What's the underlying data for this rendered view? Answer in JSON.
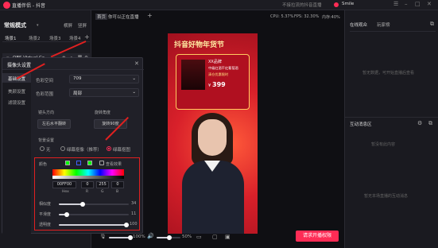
{
  "app": {
    "title": "直播伴侣 - 抖音",
    "user": "Smile",
    "nofail": "不接拉流的抖音直播"
  },
  "left": {
    "mode": "常规模式",
    "tabs": [
      "场景1",
      "场景2",
      "场景3",
      "场景4"
    ],
    "add_tab": "+",
    "actions": [
      "横屏",
      "竖屏"
    ],
    "source": "OBS Virtual Ca..."
  },
  "top": {
    "tag": "首页",
    "status": "你可以正在直播",
    "stats": [
      "CPU: 5.37%",
      "FPS: 32.30%",
      "内存:40%"
    ]
  },
  "dialog": {
    "title": "摄像头设置",
    "nav": [
      "基础设置",
      "美颜设置",
      "滤镜设置"
    ],
    "fields": [
      {
        "label": "色彩空间",
        "value": "709"
      },
      {
        "label": "色彩范围",
        "value": "局部"
      }
    ],
    "mirror_label": "镜头方向",
    "mirror_btn": "左右水平翻转",
    "rotate_label": "旋转角度",
    "rotate_btn": "旋转90度",
    "bg_label": "背景设置",
    "bg_options": [
      "无",
      "绿幕抠像（推荐）",
      "绿幕抠图"
    ],
    "color_label": "颜色",
    "preview_label": "查看效果",
    "hex": "00FF00",
    "r": "0",
    "g": "255",
    "b": "0",
    "hex_l": "Hex",
    "r_l": "R",
    "g_l": "G",
    "b_l": "B",
    "sliders": [
      {
        "name": "相似度",
        "value": "34",
        "pct": 0.34
      },
      {
        "name": "平滑度",
        "value": "11",
        "pct": 0.11
      },
      {
        "name": "透明度",
        "value": "100",
        "pct": 1.0
      }
    ]
  },
  "poster": {
    "title": "抖音好物年货节",
    "badge": "XX品牌",
    "line1": "中级红酒干红葡萄酒",
    "line2": "清仓优惠限时",
    "price": "399"
  },
  "bottom": {
    "vol1": "100%",
    "vol2": "50%",
    "live_btn": "开播权限",
    "live_full": "请求开播权限"
  },
  "right": {
    "tabs": [
      "在线观众",
      "玩家榜"
    ],
    "empty1": "暂无数据，可开始直播后查看",
    "panel2": "互动消息区",
    "empty2": "暂没有此内容",
    "empty3": "暂无本场直播的互动消息"
  },
  "colors": {
    "accent": "#fe2c55",
    "green": "#00ff00",
    "red": "#e02020"
  }
}
